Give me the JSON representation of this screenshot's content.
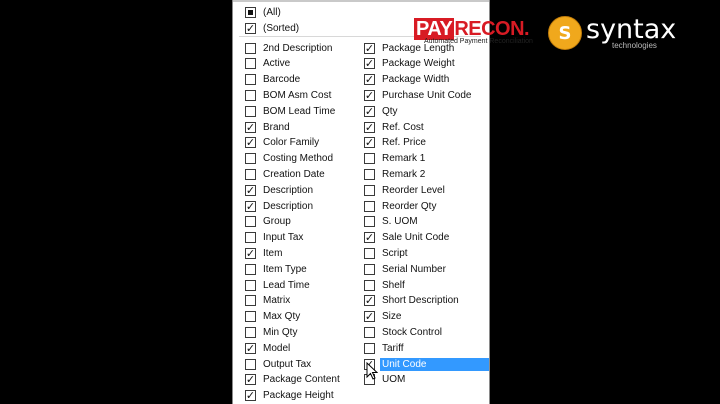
{
  "top_items": [
    {
      "label": "(All)",
      "state": "partial"
    },
    {
      "label": "(Sorted)",
      "state": "checked"
    }
  ],
  "left_column": [
    {
      "label": "2nd Description",
      "checked": false
    },
    {
      "label": "Active",
      "checked": false
    },
    {
      "label": "Barcode",
      "checked": false
    },
    {
      "label": "BOM Asm Cost",
      "checked": false
    },
    {
      "label": "BOM Lead Time",
      "checked": false
    },
    {
      "label": "Brand",
      "checked": true
    },
    {
      "label": "Color Family",
      "checked": true
    },
    {
      "label": "Costing Method",
      "checked": false
    },
    {
      "label": "Creation Date",
      "checked": false
    },
    {
      "label": "Description",
      "checked": true
    },
    {
      "label": "Description",
      "checked": true
    },
    {
      "label": "Group",
      "checked": false
    },
    {
      "label": "Input Tax",
      "checked": false
    },
    {
      "label": "Item",
      "checked": true
    },
    {
      "label": "Item Type",
      "checked": false
    },
    {
      "label": "Lead Time",
      "checked": false
    },
    {
      "label": "Matrix",
      "checked": false
    },
    {
      "label": "Max Qty",
      "checked": false
    },
    {
      "label": "Min Qty",
      "checked": false
    },
    {
      "label": "Model",
      "checked": true
    },
    {
      "label": "Output Tax",
      "checked": false
    },
    {
      "label": "Package Content",
      "checked": true
    },
    {
      "label": "Package Height",
      "checked": true
    }
  ],
  "right_column": [
    {
      "label": "Package Length",
      "checked": true
    },
    {
      "label": "Package Weight",
      "checked": true
    },
    {
      "label": "Package Width",
      "checked": true
    },
    {
      "label": "Purchase Unit Code",
      "checked": true
    },
    {
      "label": "Qty",
      "checked": true
    },
    {
      "label": "Ref. Cost",
      "checked": true
    },
    {
      "label": "Ref. Price",
      "checked": true
    },
    {
      "label": "Remark 1",
      "checked": false
    },
    {
      "label": "Remark 2",
      "checked": false
    },
    {
      "label": "Reorder Level",
      "checked": false
    },
    {
      "label": "Reorder Qty",
      "checked": false
    },
    {
      "label": "S. UOM",
      "checked": false
    },
    {
      "label": "Sale Unit Code",
      "checked": true
    },
    {
      "label": "Script",
      "checked": false
    },
    {
      "label": "Serial Number",
      "checked": false
    },
    {
      "label": "Shelf",
      "checked": false
    },
    {
      "label": "Short Description",
      "checked": true
    },
    {
      "label": "Size",
      "checked": true
    },
    {
      "label": "Stock Control",
      "checked": false
    },
    {
      "label": "Tariff",
      "checked": false
    },
    {
      "label": "Unit Code",
      "checked": true,
      "highlighted": true
    },
    {
      "label": "UOM",
      "checked": false
    }
  ],
  "watermarks": {
    "payrecon": {
      "pay": "PAY",
      "recon": "RECON",
      "tagline": "Automated Payment Reconciliation"
    },
    "syntax": {
      "name": "syntax",
      "tagline": "technologies"
    }
  },
  "colors": {
    "highlight": "#3399ff",
    "payrecon_red": "#d81b24",
    "syntax_orange": "#f0a81c"
  }
}
